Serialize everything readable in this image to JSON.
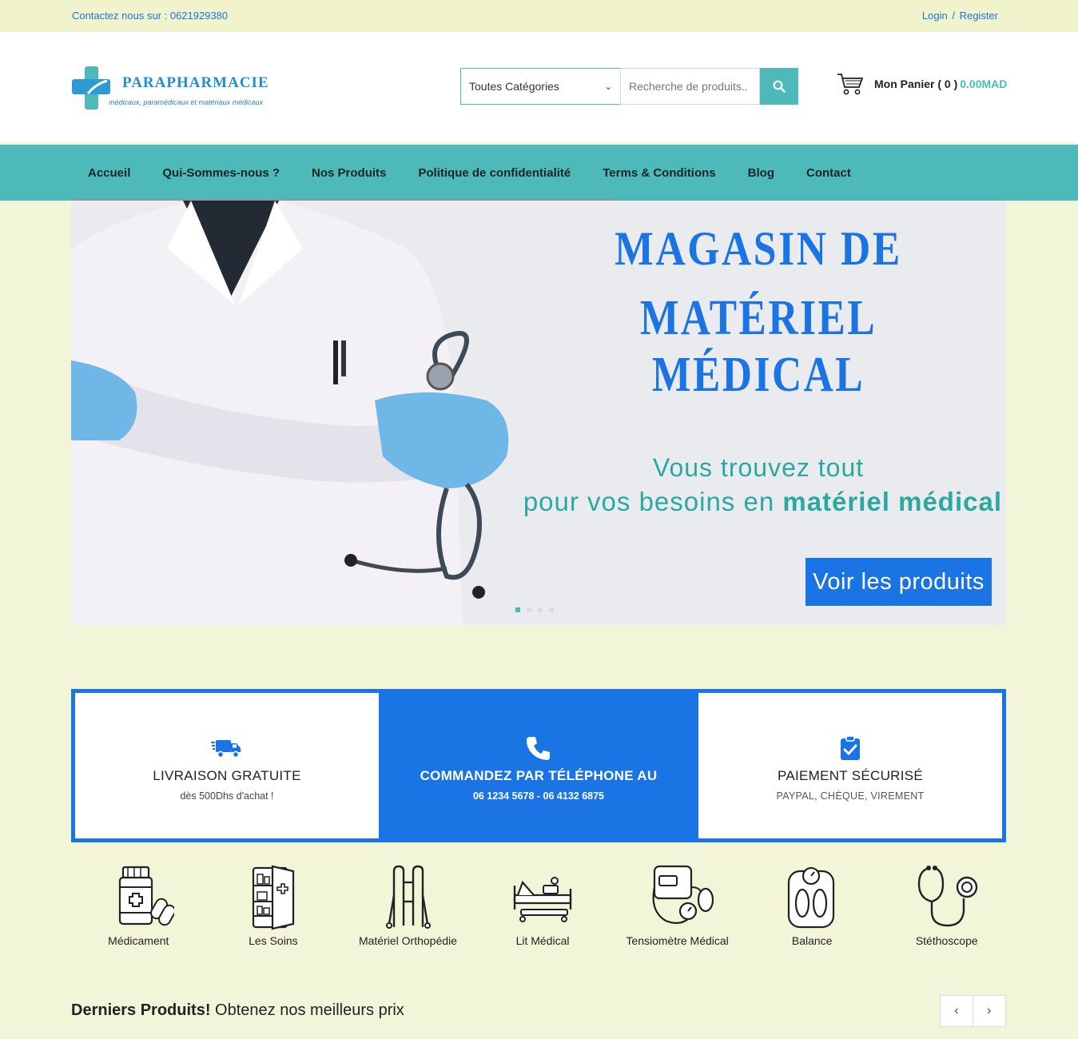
{
  "topbar": {
    "contact": "Contactez nous sur : 0621929380",
    "login": "Login",
    "separator": "/",
    "register": "Register"
  },
  "header": {
    "logo_brand": "PARAPHARMACIE",
    "logo_tagline": "médicaux, paramédicaux et matériaux médicaux",
    "category_select": "Toutes Catégories",
    "search_placeholder": "Recherche de produits..",
    "cart_label": "Mon Panier ( 0 )",
    "cart_amount": "0.00MAD"
  },
  "nav": {
    "items": [
      {
        "label": "Accueil"
      },
      {
        "label": "Qui-Sommes-nous ?"
      },
      {
        "label": "Nos Produits"
      },
      {
        "label": "Politique de confidentialité"
      },
      {
        "label": "Terms & Conditions"
      },
      {
        "label": "Blog"
      },
      {
        "label": "Contact"
      }
    ]
  },
  "hero": {
    "title_line1": "MAGASIN DE",
    "title_line2": "MATÉRIEL MÉDICAL",
    "subtitle_line1": "Vous trouvez tout",
    "subtitle_line2_prefix": "pour vos besoins en ",
    "subtitle_line2_bold": "matériel médical",
    "cta": "Voir les produits"
  },
  "services": [
    {
      "title": "LIVRAISON GRATUITE",
      "text": "dès 500Dhs d'achat !",
      "icon": "truck-icon"
    },
    {
      "title": "COMMANDEZ PAR TÉLÉPHONE AU",
      "text": "06 1234 5678 - 06 4132 6875",
      "icon": "phone-icon"
    },
    {
      "title": "PAIEMENT SÉCURISÉ",
      "text": "PAYPAL, CHÈQUE, VIREMENT",
      "icon": "clipboard-check-icon"
    }
  ],
  "categories": [
    {
      "label": "Médicament",
      "icon": "medicine-icon"
    },
    {
      "label": "Les Soins",
      "icon": "cabinet-icon"
    },
    {
      "label": "Matériel Orthopédie",
      "icon": "walker-icon"
    },
    {
      "label": "Lit Médical",
      "icon": "bed-icon"
    },
    {
      "label": "Tensiomètre Médical",
      "icon": "blood-pressure-icon"
    },
    {
      "label": "Balance",
      "icon": "scale-icon"
    },
    {
      "label": "Stéthoscope",
      "icon": "stethoscope-icon"
    }
  ],
  "latest": {
    "bold": "Derniers Produits!",
    "rest": " Obtenez nos meilleurs prix"
  },
  "colors": {
    "accent_teal": "#4dbab9",
    "accent_blue": "#1b74e4",
    "page_background": "#f3f5d9"
  }
}
